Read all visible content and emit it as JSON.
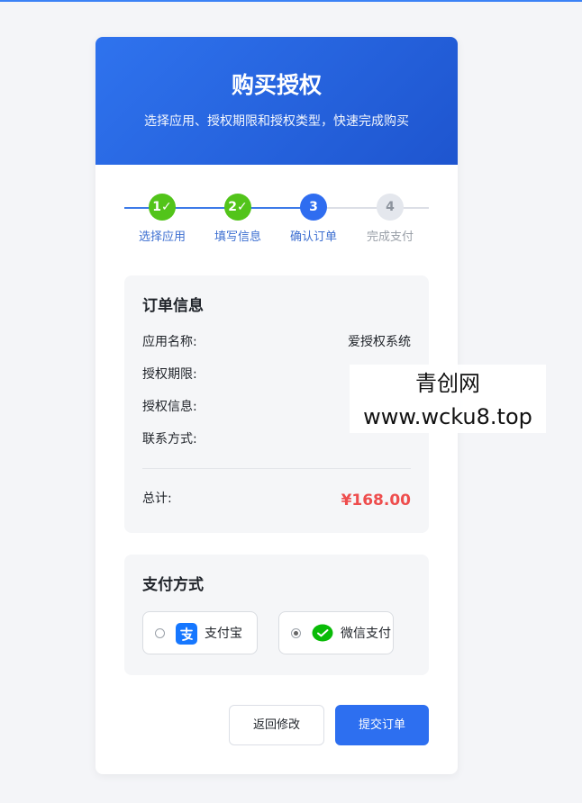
{
  "header": {
    "title": "购买授权",
    "subtitle": "选择应用、授权期限和授权类型，快速完成购买"
  },
  "steps": [
    {
      "number": "1✓",
      "label": "选择应用",
      "state": "done"
    },
    {
      "number": "2✓",
      "label": "填写信息",
      "state": "done"
    },
    {
      "number": "3",
      "label": "确认订单",
      "state": "current"
    },
    {
      "number": "4",
      "label": "完成支付",
      "state": "pending"
    }
  ],
  "order": {
    "title": "订单信息",
    "app_name_label": "应用名称:",
    "app_name_value": "爱授权系统",
    "period_label": "授权期限:",
    "info_label": "授权信息:",
    "contact_label": "联系方式:",
    "total_label": "总计:",
    "total_value": "¥168.00"
  },
  "payment": {
    "title": "支付方式",
    "options": [
      {
        "label": "支付宝",
        "icon": "alipay-icon",
        "selected": false
      },
      {
        "label": "微信支付",
        "icon": "wechat-pay-icon",
        "selected": true
      }
    ]
  },
  "actions": {
    "back_label": "返回修改",
    "submit_label": "提交订单"
  },
  "watermark": {
    "line1": "青创网",
    "line2": "www.wcku8.top"
  },
  "colors": {
    "primary": "#2d6ff0",
    "success": "#52c41a",
    "price": "#ee4d4d"
  }
}
